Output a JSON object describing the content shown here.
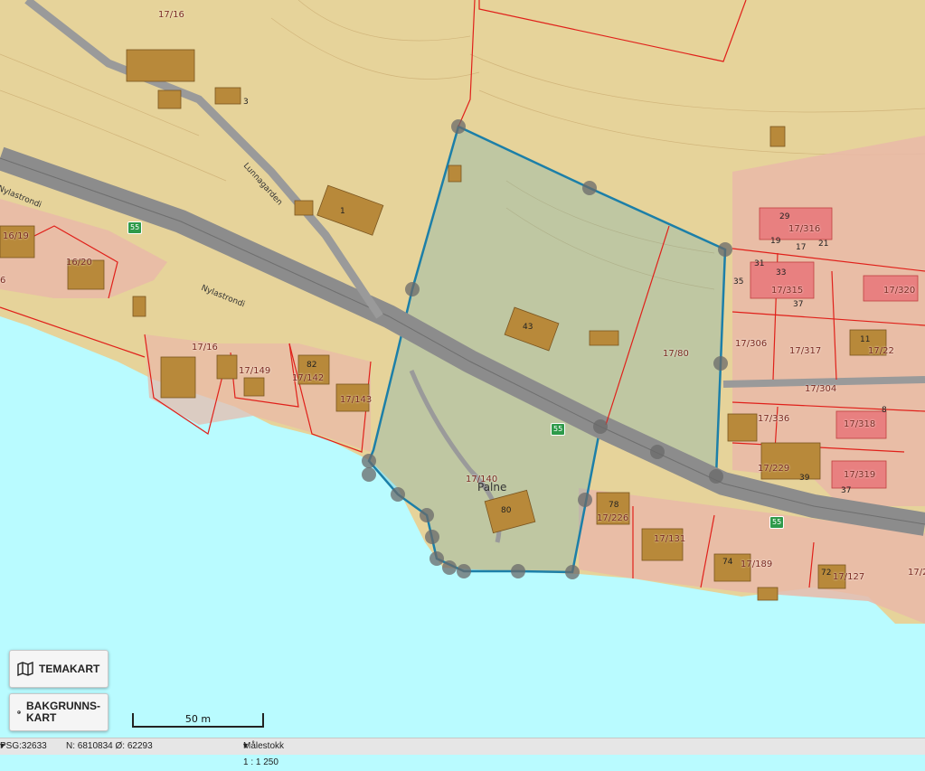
{
  "map": {
    "parcel_labels": [
      "17/16",
      "16/19",
      "16/20",
      "6",
      "17/16",
      "17/149",
      "17/142",
      "17/143",
      "17/140",
      "17/80",
      "17/316",
      "17/315",
      "17/320",
      "17/306",
      "17/317",
      "17/22",
      "17/304",
      "17/336",
      "17/318",
      "17/229",
      "17/319",
      "17/226",
      "17/131",
      "17/189",
      "17/127",
      "17/2"
    ],
    "house_numbers": [
      "3",
      "1",
      "43",
      "82",
      "80",
      "29",
      "19",
      "17",
      "21",
      "31",
      "33",
      "35",
      "37",
      "11",
      "8",
      "39",
      "37",
      "78",
      "74",
      "72"
    ],
    "road_number": "55",
    "street_names": [
      "Lunnagarden",
      "Nylastrondi",
      "Nylastrondi"
    ],
    "place_name": "Palne",
    "colors": {
      "water": "#b9fbff",
      "farmland": "#e6d39a",
      "residential": "#e9b8a8",
      "road": "#8c8c8c",
      "parcel_border": "#e0201a",
      "selection": "#1c7fa8"
    }
  },
  "controls": {
    "temakart_label": "TEMAKART",
    "temakart_icon": "map-icon",
    "bakgrunnskart_label_1": "BAKGRUNNS-",
    "bakgrunnskart_label_2": "KART",
    "bakgrunnskart_icon": "globe-icon"
  },
  "scalebar": {
    "label": "50 m"
  },
  "status": {
    "crs": "PSG:32633",
    "coords": "N: 6810834 Ø: 62293",
    "scale": "Målestokk 1 : 1 250"
  }
}
